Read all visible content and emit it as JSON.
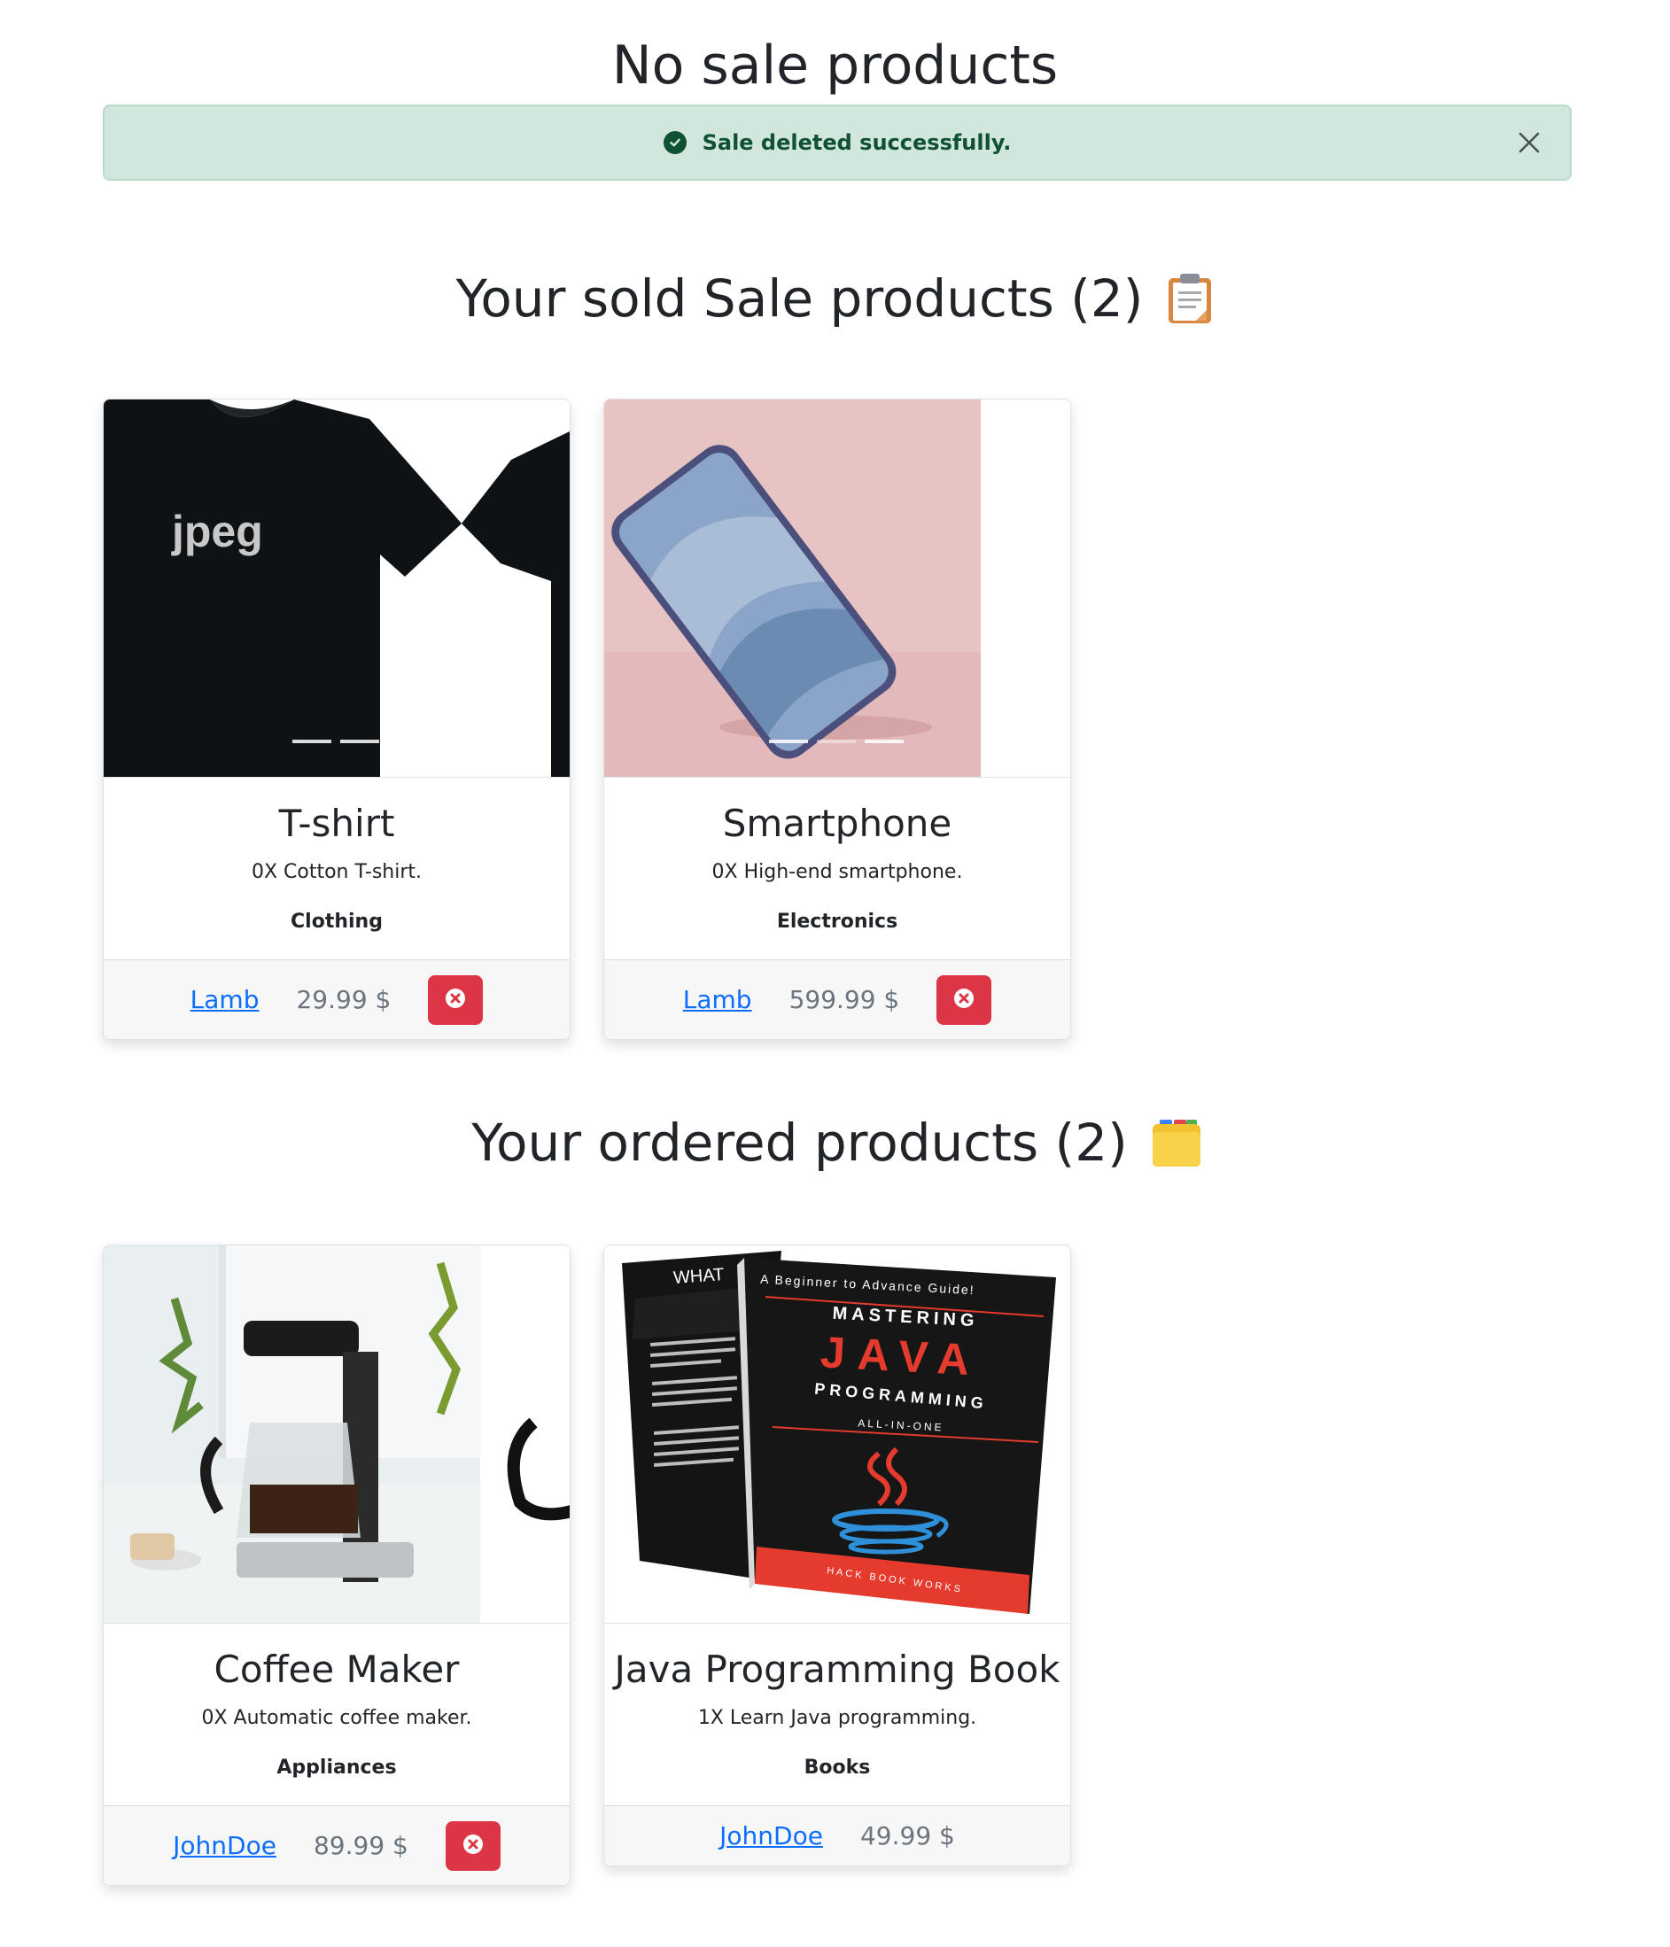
{
  "page": {
    "title": "No sale products"
  },
  "alert": {
    "message": "Sale deleted successfully.",
    "icon": "check-circle-icon",
    "close_icon": "close-icon"
  },
  "sold_section": {
    "title": "Your sold Sale products (2)",
    "icon": "clipboard-icon"
  },
  "ordered_section": {
    "title": "Your ordered products (2)",
    "icon": "card-index-dividers-icon"
  },
  "sold_products": [
    {
      "name": "T-shirt",
      "description": "0X Cotton T-shirt.",
      "category": "Clothing",
      "seller": "Lamb",
      "price": "29.99 $",
      "image_text": "jpeg"
    },
    {
      "name": "Smartphone",
      "description": "0X High-end smartphone.",
      "category": "Electronics",
      "seller": "Lamb",
      "price": "599.99 $"
    }
  ],
  "ordered_products": [
    {
      "name": "Coffee Maker",
      "description": "0X Automatic coffee maker.",
      "category": "Appliances",
      "seller": "JohnDoe",
      "price": "89.99 $"
    },
    {
      "name": "Java Programming Book",
      "description": "1X Learn Java programming.",
      "category": "Books",
      "seller": "JohnDoe",
      "price": "49.99 $",
      "book": {
        "tagline": "A Beginner to Advance Guide!",
        "line1": "MASTERING",
        "line2": "JAVA",
        "line3": "PROGRAMMING",
        "line4": "ALL-IN-ONE",
        "publisher": "HACK BOOK WORKS",
        "back_title": "WHAT"
      }
    }
  ]
}
